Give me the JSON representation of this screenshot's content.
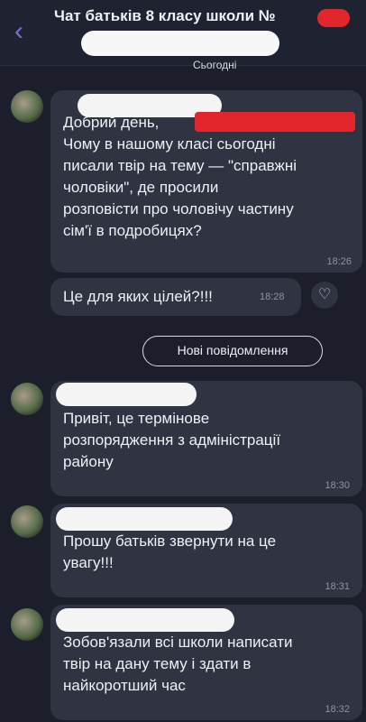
{
  "header": {
    "title": "Чат батьків 8 класу школи №",
    "back_icon": "chevron-left-icon"
  },
  "date_separator": "Сьогодні",
  "new_messages_label": "Нові повідомлення",
  "messages": [
    {
      "lines": [
        "Добрий день,",
        "Чому в нашому класі сьогодні",
        "писали твір на тему — \"справжні",
        "чоловіки\", де просили",
        "розповісти про чоловічу частину",
        "сім'ї в подробицях?"
      ],
      "time": "18:26"
    },
    {
      "lines": [
        "Це для яких цілей?!!!"
      ],
      "time": "18:28"
    },
    {
      "lines": [
        "Привіт, це термінове",
        "розпорядження з адміністрації",
        "району"
      ],
      "time": "18:30"
    },
    {
      "lines": [
        "Прошу батьків звернути на це",
        "увагу!!!"
      ],
      "time": "18:31"
    },
    {
      "lines": [
        "Зобов'язали всі школи написати",
        "твір на дану тему і здати в",
        "найкоротший час"
      ],
      "time": "18:32"
    }
  ],
  "colors": {
    "background": "#1c1f2b",
    "bubble": "#2f3342",
    "accent": "#7d6bd6",
    "redaction": "#e3262c"
  }
}
